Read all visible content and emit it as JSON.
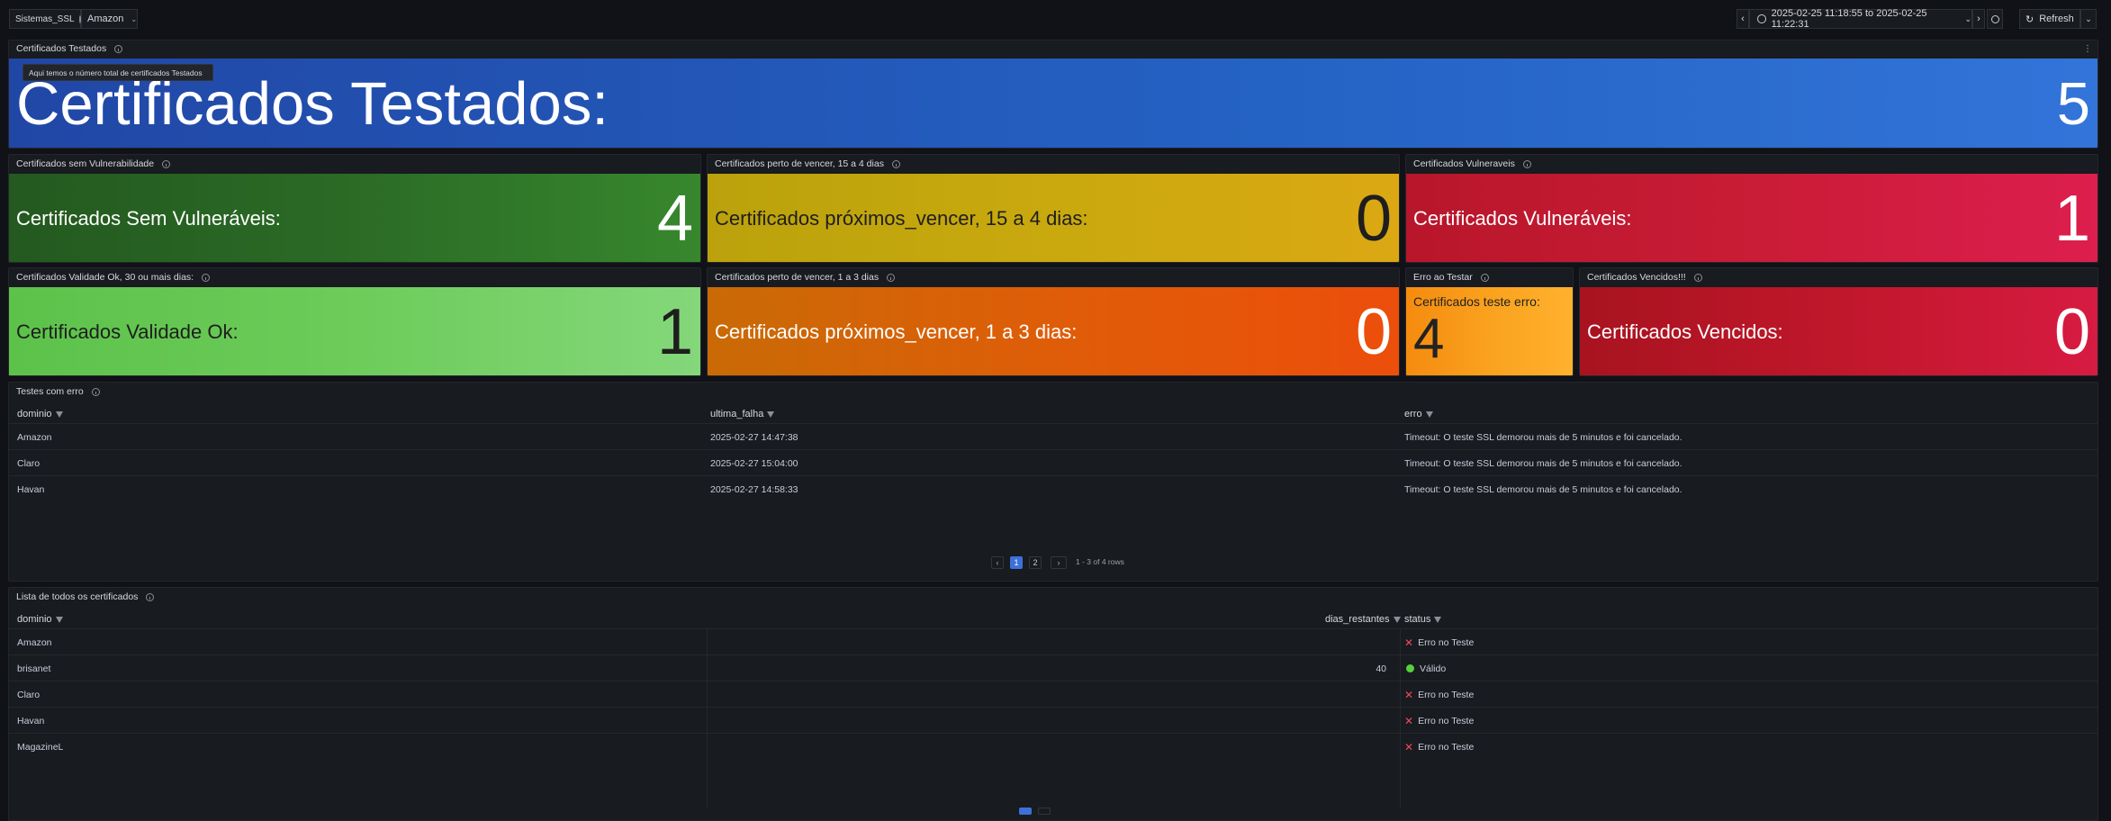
{
  "topbar": {
    "variable_name": "Sistemas_SSL",
    "variable_value": "Amazon",
    "time_range": "2025-02-25 11:18:55 to 2025-02-25 11:22:31",
    "refresh_label": "Refresh"
  },
  "panels": {
    "testados": {
      "title": "Certificados Testados",
      "tooltip": "Aqui temos o número total de certificados Testados",
      "label": "Certificados Testados:",
      "value": "5"
    },
    "sem_vuln": {
      "title": "Certificados sem Vulnerabilidade",
      "label": "Certificados Sem Vulneráveis:",
      "value": "4"
    },
    "perto_15": {
      "title": "Certificados perto de vencer, 15 a 4 dias",
      "label": "Certificados próximos_vencer, 15 a 4 dias:",
      "value": "0"
    },
    "vulneraveis": {
      "title": "Certificados Vulneraveis",
      "label": "Certificados Vulneráveis:",
      "value": "1"
    },
    "validade_ok": {
      "title": "Certificados Validade Ok, 30 ou mais dias:",
      "label": "Certificados Validade Ok:",
      "value": "1"
    },
    "perto_3": {
      "title": "Certificados perto de vencer, 1 a 3 dias",
      "label": "Certificados próximos_vencer, 1 a 3 dias:",
      "value": "0"
    },
    "erro_testar": {
      "title": "Erro ao Testar",
      "label": "Certificados teste erro:",
      "value": "4"
    },
    "vencidos": {
      "title": "Certificados Vencidos!!!",
      "label": "Certificados Vencidos:",
      "value": "0"
    }
  },
  "testes_erro": {
    "title": "Testes com erro",
    "columns": [
      "dominio",
      "ultima_falha",
      "erro"
    ],
    "rows": [
      [
        "Amazon",
        "2025-02-27 14:47:38",
        "Timeout: O teste SSL demorou mais de 5 minutos e foi cancelado."
      ],
      [
        "Claro",
        "2025-02-27 15:04:00",
        "Timeout: O teste SSL demorou mais de 5 minutos e foi cancelado."
      ],
      [
        "Havan",
        "2025-02-27 14:58:33",
        "Timeout: O teste SSL demorou mais de 5 minutos e foi cancelado."
      ]
    ],
    "pagination": {
      "prev": "‹",
      "page1": "1",
      "page2": "2",
      "next": "›",
      "summary": "1 - 3 of 4 rows"
    }
  },
  "lista": {
    "title": "Lista de todos os certificados",
    "columns": [
      "dominio",
      "dias_restantes",
      "status"
    ],
    "rows": [
      {
        "dominio": "Amazon",
        "dias": "",
        "status": "Erro no Teste",
        "status_icon": "x-icon"
      },
      {
        "dominio": "brisanet",
        "dias": "40",
        "status": "Válido",
        "status_icon": "green-dot-icon"
      },
      {
        "dominio": "Claro",
        "dias": "",
        "status": "Erro no Teste",
        "status_icon": "x-icon"
      },
      {
        "dominio": "Havan",
        "dias": "",
        "status": "Erro no Teste",
        "status_icon": "x-icon"
      },
      {
        "dominio": "MagazineL",
        "dias": "",
        "status": "Erro no Teste",
        "status_icon": "x-icon"
      }
    ]
  },
  "colors": {
    "error_x": "#f2495c",
    "valid_dot": "#56d13e",
    "active_page": "#3d71d9"
  }
}
